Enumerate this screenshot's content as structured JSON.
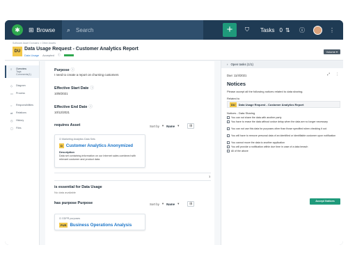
{
  "topbar": {
    "browse_label": "Browse",
    "search_placeholder": "Search",
    "add_label": "+",
    "tasks_label": "Tasks",
    "tasks_count": "0"
  },
  "header": {
    "breadcrumb": "Software Asset Domains  >  Other Assets",
    "badge": "DU",
    "title": "Data Usage Request - Customer Analytics Report",
    "type": "Data Usage",
    "status": "Accepted",
    "volume_label": "Volume"
  },
  "nav": {
    "items": [
      {
        "label": "Overview",
        "sub": "Tags\nComments(1)",
        "icon": "≡"
      },
      {
        "label": "Diagram",
        "icon": "◇"
      },
      {
        "label": "Process",
        "icon": "▭"
      },
      {
        "label": "Responsibilities",
        "icon": "○"
      },
      {
        "label": "Relations",
        "icon": "⇄"
      },
      {
        "label": "History",
        "icon": "◷"
      },
      {
        "label": "Files",
        "icon": "▢"
      }
    ]
  },
  "main": {
    "purpose_label": "Purpose",
    "purpose_value": "I need to create a report on churning customers",
    "start_label": "Effective Start Date",
    "start_value": "10/8/2021",
    "end_label": "Effective End Date",
    "end_value": "10/12/2021",
    "requires_label": "requires Asset",
    "sort_label": "Sort by",
    "sort_value": "Name",
    "card1": {
      "category": "Marketing Analytics Data Sets",
      "tag": "D",
      "name": "Customer Analytics Anonymized",
      "desc_label": "Description",
      "desc_text": "Data set containing information on our Internet sales combined with relevant customer and product data."
    },
    "page": "1",
    "essential_label": "is essential for Data Usage",
    "essential_value": "No data available",
    "haspurpose_label": "has purpose Purpose",
    "card2": {
      "category": "GDPR purposes",
      "tag": "PUR",
      "name": "Business Operations Analysis"
    }
  },
  "panel": {
    "open_tasks": "Open tasks (1/1)",
    "due": "Due: 11/4/2021",
    "heading": "Notices",
    "instruction": "Please accept all the following notices related to data sharing.",
    "related_to": "Related to",
    "related_badge": "DU",
    "related_name": "Data Usage Request - Customer Analytics Report",
    "notices_label": "Notices - Data Sharing",
    "checks": [
      "You can not share the data with another party",
      "You have to erase the data without undue delay when the data are no longer necessary",
      "You can not use this data for purposes other than those specified when checking it out.",
      "You will have to remove personal data of an identified or identifiable customer upon notification",
      "You cannot move the data to another application",
      "You will provide a notification within due time in case of a data breach",
      "All of the above"
    ],
    "accept_label": "Accept Notices"
  },
  "colors": {
    "topbar": "#1f3b54",
    "accent_green": "#1f9a7b",
    "link_blue": "#1a74c8",
    "badge_yellow": "#f2c74a"
  }
}
